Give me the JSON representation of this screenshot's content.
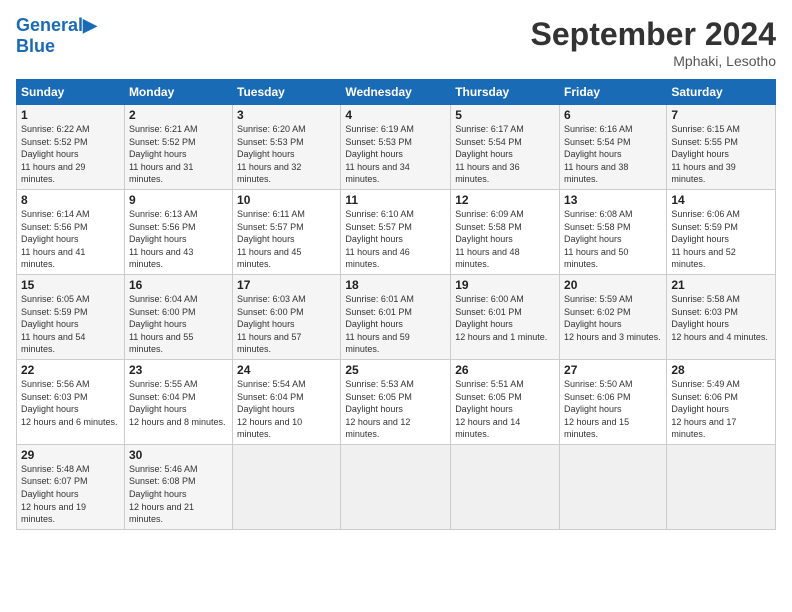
{
  "header": {
    "logo_line1": "General",
    "logo_line2": "Blue",
    "month": "September 2024",
    "location": "Mphaki, Lesotho"
  },
  "weekdays": [
    "Sunday",
    "Monday",
    "Tuesday",
    "Wednesday",
    "Thursday",
    "Friday",
    "Saturday"
  ],
  "weeks": [
    [
      {
        "day": "1",
        "sunrise": "6:22 AM",
        "sunset": "5:52 PM",
        "daylight": "11 hours and 29 minutes."
      },
      {
        "day": "2",
        "sunrise": "6:21 AM",
        "sunset": "5:52 PM",
        "daylight": "11 hours and 31 minutes."
      },
      {
        "day": "3",
        "sunrise": "6:20 AM",
        "sunset": "5:53 PM",
        "daylight": "11 hours and 32 minutes."
      },
      {
        "day": "4",
        "sunrise": "6:19 AM",
        "sunset": "5:53 PM",
        "daylight": "11 hours and 34 minutes."
      },
      {
        "day": "5",
        "sunrise": "6:17 AM",
        "sunset": "5:54 PM",
        "daylight": "11 hours and 36 minutes."
      },
      {
        "day": "6",
        "sunrise": "6:16 AM",
        "sunset": "5:54 PM",
        "daylight": "11 hours and 38 minutes."
      },
      {
        "day": "7",
        "sunrise": "6:15 AM",
        "sunset": "5:55 PM",
        "daylight": "11 hours and 39 minutes."
      }
    ],
    [
      {
        "day": "8",
        "sunrise": "6:14 AM",
        "sunset": "5:56 PM",
        "daylight": "11 hours and 41 minutes."
      },
      {
        "day": "9",
        "sunrise": "6:13 AM",
        "sunset": "5:56 PM",
        "daylight": "11 hours and 43 minutes."
      },
      {
        "day": "10",
        "sunrise": "6:11 AM",
        "sunset": "5:57 PM",
        "daylight": "11 hours and 45 minutes."
      },
      {
        "day": "11",
        "sunrise": "6:10 AM",
        "sunset": "5:57 PM",
        "daylight": "11 hours and 46 minutes."
      },
      {
        "day": "12",
        "sunrise": "6:09 AM",
        "sunset": "5:58 PM",
        "daylight": "11 hours and 48 minutes."
      },
      {
        "day": "13",
        "sunrise": "6:08 AM",
        "sunset": "5:58 PM",
        "daylight": "11 hours and 50 minutes."
      },
      {
        "day": "14",
        "sunrise": "6:06 AM",
        "sunset": "5:59 PM",
        "daylight": "11 hours and 52 minutes."
      }
    ],
    [
      {
        "day": "15",
        "sunrise": "6:05 AM",
        "sunset": "5:59 PM",
        "daylight": "11 hours and 54 minutes."
      },
      {
        "day": "16",
        "sunrise": "6:04 AM",
        "sunset": "6:00 PM",
        "daylight": "11 hours and 55 minutes."
      },
      {
        "day": "17",
        "sunrise": "6:03 AM",
        "sunset": "6:00 PM",
        "daylight": "11 hours and 57 minutes."
      },
      {
        "day": "18",
        "sunrise": "6:01 AM",
        "sunset": "6:01 PM",
        "daylight": "11 hours and 59 minutes."
      },
      {
        "day": "19",
        "sunrise": "6:00 AM",
        "sunset": "6:01 PM",
        "daylight": "12 hours and 1 minute."
      },
      {
        "day": "20",
        "sunrise": "5:59 AM",
        "sunset": "6:02 PM",
        "daylight": "12 hours and 3 minutes."
      },
      {
        "day": "21",
        "sunrise": "5:58 AM",
        "sunset": "6:03 PM",
        "daylight": "12 hours and 4 minutes."
      }
    ],
    [
      {
        "day": "22",
        "sunrise": "5:56 AM",
        "sunset": "6:03 PM",
        "daylight": "12 hours and 6 minutes."
      },
      {
        "day": "23",
        "sunrise": "5:55 AM",
        "sunset": "6:04 PM",
        "daylight": "12 hours and 8 minutes."
      },
      {
        "day": "24",
        "sunrise": "5:54 AM",
        "sunset": "6:04 PM",
        "daylight": "12 hours and 10 minutes."
      },
      {
        "day": "25",
        "sunrise": "5:53 AM",
        "sunset": "6:05 PM",
        "daylight": "12 hours and 12 minutes."
      },
      {
        "day": "26",
        "sunrise": "5:51 AM",
        "sunset": "6:05 PM",
        "daylight": "12 hours and 14 minutes."
      },
      {
        "day": "27",
        "sunrise": "5:50 AM",
        "sunset": "6:06 PM",
        "daylight": "12 hours and 15 minutes."
      },
      {
        "day": "28",
        "sunrise": "5:49 AM",
        "sunset": "6:06 PM",
        "daylight": "12 hours and 17 minutes."
      }
    ],
    [
      {
        "day": "29",
        "sunrise": "5:48 AM",
        "sunset": "6:07 PM",
        "daylight": "12 hours and 19 minutes."
      },
      {
        "day": "30",
        "sunrise": "5:46 AM",
        "sunset": "6:08 PM",
        "daylight": "12 hours and 21 minutes."
      },
      null,
      null,
      null,
      null,
      null
    ]
  ]
}
